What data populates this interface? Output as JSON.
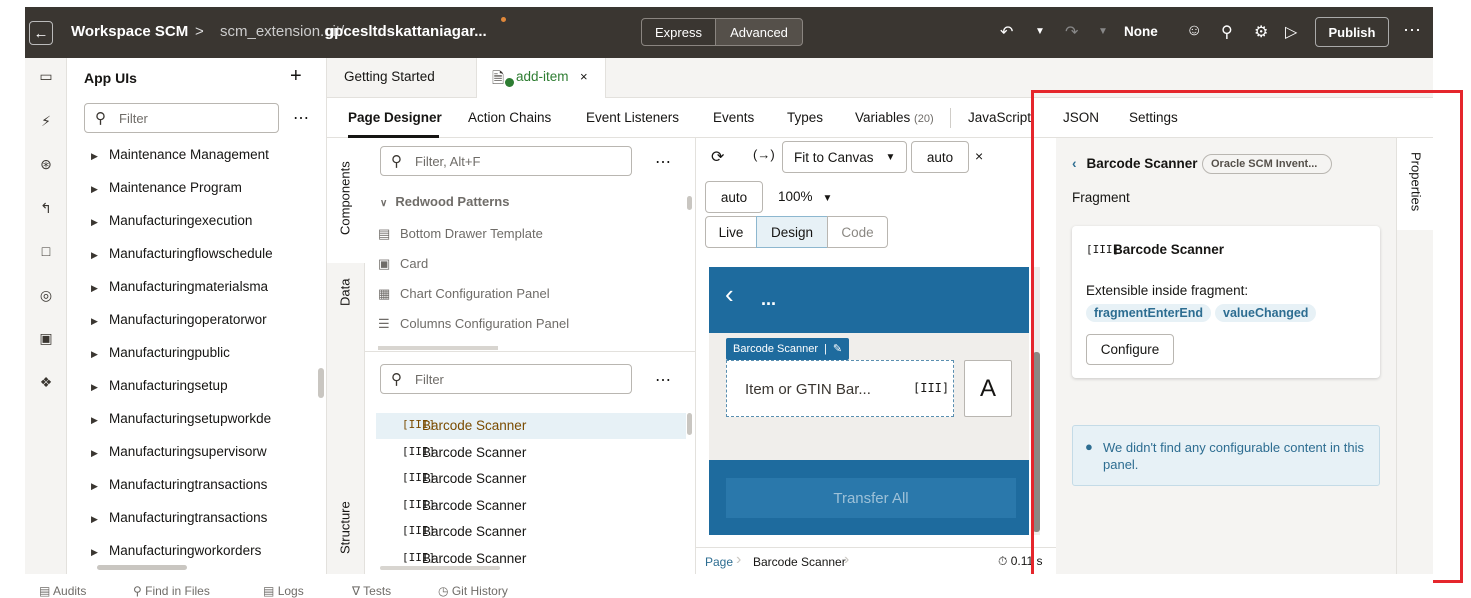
{
  "header": {
    "workspace": "Workspace SCM",
    "sep": ">",
    "repo": "scm_extension.git/",
    "branch": "gpcesltdskattaniagar...",
    "express": "Express",
    "advanced": "Advanced",
    "none_label": "None",
    "publish": "Publish",
    "more": "⋯"
  },
  "app_panel": {
    "title": "App UIs",
    "filter_placeholder": "Filter",
    "items": [
      "Maintenance Management",
      "Maintenance Program",
      "Manufacturingexecution",
      "Manufacturingflowschedule",
      "Manufacturingmaterialsma",
      "Manufacturingoperatorwor",
      "Manufacturingpublic",
      "Manufacturingsetup",
      "Manufacturingsetupworkde",
      "Manufacturingsupervisorw",
      "Manufacturingtransactions",
      "Manufacturingtransactions",
      "Manufacturingworkorders"
    ]
  },
  "file_tabs": {
    "getting_started": "Getting Started",
    "add_item": "add-item"
  },
  "designer_tabs": {
    "page_designer": "Page Designer",
    "action_chains": "Action Chains",
    "event_listeners": "Event Listeners",
    "events": "Events",
    "types": "Types",
    "variables": "Variables",
    "variables_count": "(20)",
    "javascript": "JavaScript",
    "json": "JSON",
    "settings": "Settings"
  },
  "side_tabs": {
    "components": "Components",
    "data": "Data",
    "structure": "Structure",
    "properties": "Properties"
  },
  "components": {
    "filter_placeholder": "Filter, Alt+F",
    "group": "Redwood Patterns",
    "items": [
      "Bottom Drawer Template",
      "Card",
      "Chart Configuration Panel",
      "Columns Configuration Panel"
    ]
  },
  "structure": {
    "filter_placeholder": "Filter",
    "items": [
      "Barcode Scanner",
      "Barcode Scanner",
      "Barcode Scanner",
      "Barcode Scanner",
      "Barcode Scanner",
      "Barcode Scanner"
    ]
  },
  "canvas": {
    "fit": "Fit to Canvas",
    "width": "auto",
    "height": "auto",
    "zoom": "100%",
    "live": "Live",
    "design": "Design",
    "code": "Code",
    "preview_back": "‹",
    "preview_dots": "...",
    "scanner_tag": "Barcode Scanner",
    "scanner_placeholder": "Item or GTIN Bar...",
    "transfer": "Transfer All",
    "breadcrumb_page": "Page",
    "breadcrumb_item": "Barcode Scanner",
    "timing": "0.11 s"
  },
  "properties": {
    "title": "Barcode Scanner",
    "badge": "Oracle SCM Invent...",
    "section": "Fragment",
    "card_title": "Barcode Scanner",
    "extensible_label": "Extensible inside fragment:",
    "events": [
      "fragmentEnterEnd",
      "valueChanged"
    ],
    "configure": "Configure",
    "info": "We didn't find any configurable content in this panel."
  },
  "bottom": {
    "items": [
      "Audits",
      "Find in Files",
      "Logs",
      "Tests",
      "Git History"
    ]
  },
  "colors": {
    "topbar": "#3a3631",
    "preview_blue": "#1e6b9e",
    "chip_bg": "#e7f1f6",
    "highlight": "#e5262c",
    "accent": "#2d6d91"
  }
}
